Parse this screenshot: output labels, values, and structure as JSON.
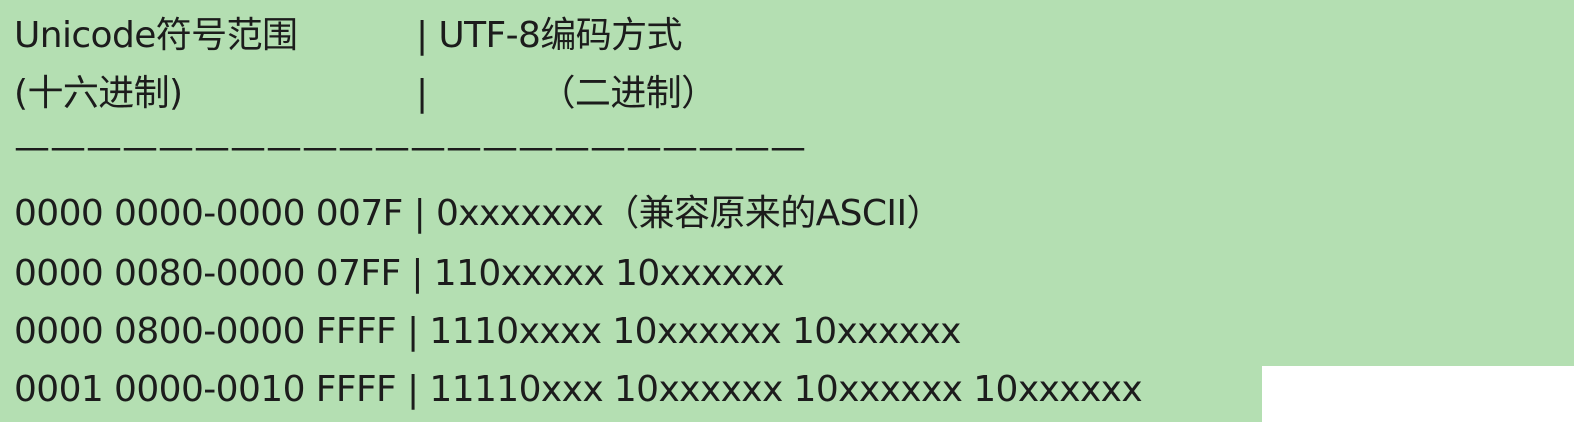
{
  "table": {
    "header": {
      "line1_left": "Unicode符号范围",
      "line1_right": "| UTF-8编码方式",
      "line2_left": "(十六进制)",
      "line2_sep": "|",
      "line2_right": "（二进制）"
    },
    "divider": "——————————————————————",
    "rows": [
      {
        "range": "0000 0000-0000 007F",
        "sep": "|",
        "encoding": "0xxxxxxx（兼容原来的ASCII）"
      },
      {
        "range": "0000 0080-0000 07FF",
        "sep": "|",
        "encoding": "110xxxxx 10xxxxxx"
      },
      {
        "range": "0000 0800-0000 FFFF",
        "sep": "|",
        "encoding": "1110xxxx 10xxxxxx 10xxxxxx"
      },
      {
        "range": "0001 0000-0010 FFFF",
        "sep": "|",
        "encoding": "11110xxx 10xxxxxx 10xxxxxx 10xxxxxx"
      }
    ]
  },
  "colors": {
    "background": "#b4dfb2",
    "text": "#1c1c1c"
  }
}
